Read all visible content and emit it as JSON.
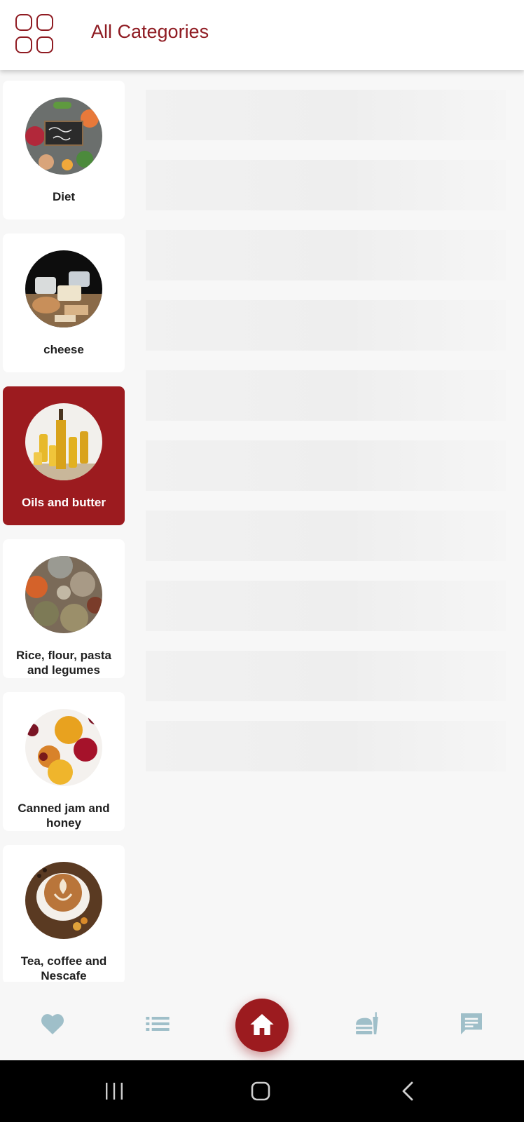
{
  "header": {
    "title": "All Categories",
    "menu_icon": "grid-icon"
  },
  "categories": [
    {
      "label": "Diet",
      "image": "balanced-diet-photo",
      "selected": false
    },
    {
      "label": "cheese",
      "image": "cheese-photo",
      "selected": false
    },
    {
      "label": "Oils and butter",
      "image": "oil-bottles-photo",
      "selected": true
    },
    {
      "label": "Rice, flour, pasta and legumes",
      "image": "grain-sacks-photo",
      "selected": false
    },
    {
      "label": "Canned jam and honey",
      "image": "jam-jars-photo",
      "selected": false
    },
    {
      "label": "Tea, coffee and Nescafe",
      "image": "coffee-cup-photo",
      "selected": false
    }
  ],
  "content": {
    "placeholder_count": 10,
    "state": "loading"
  },
  "bottom_nav": {
    "items": [
      {
        "icon": "heart-icon",
        "selected": false
      },
      {
        "icon": "list-icon",
        "selected": false
      },
      {
        "icon": "home-icon",
        "selected": true
      },
      {
        "icon": "fast-food-icon",
        "selected": false
      },
      {
        "icon": "chat-icon",
        "selected": false
      }
    ]
  },
  "colors": {
    "accent": "#9c1b1f",
    "title": "#8f1b22",
    "nav_icon": "#9fbfc9",
    "background": "#f7f7f7"
  }
}
